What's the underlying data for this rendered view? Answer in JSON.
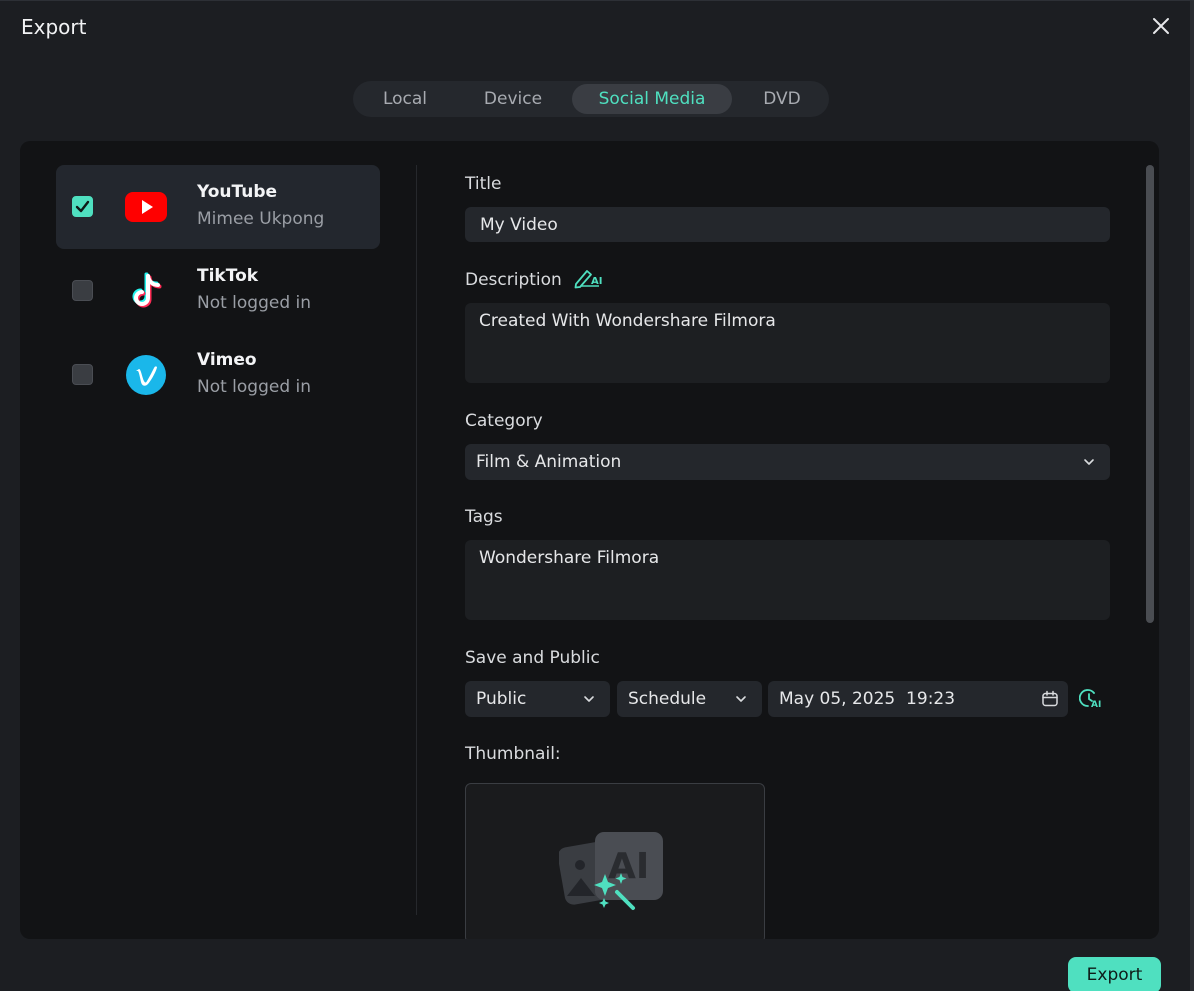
{
  "window": {
    "title": "Export"
  },
  "tabs": [
    {
      "label": "Local",
      "active": false
    },
    {
      "label": "Device",
      "active": false
    },
    {
      "label": "Social Media",
      "active": true
    },
    {
      "label": "DVD",
      "active": false
    }
  ],
  "platforms": [
    {
      "name": "YouTube",
      "status": "Mimee Ukpong",
      "checked": true,
      "icon": "youtube-icon"
    },
    {
      "name": "TikTok",
      "status": "Not logged in",
      "checked": false,
      "icon": "tiktok-icon"
    },
    {
      "name": "Vimeo",
      "status": "Not logged in",
      "checked": false,
      "icon": "vimeo-icon"
    }
  ],
  "form": {
    "title_label": "Title",
    "title_value": "My Video",
    "description_label": "Description",
    "description_value": "Created With Wondershare Filmora",
    "category_label": "Category",
    "category_value": "Film & Animation",
    "tags_label": "Tags",
    "tags_value": "Wondershare Filmora",
    "save_label": "Save and Public",
    "privacy_value": "Public",
    "publish_mode_value": "Schedule",
    "schedule_datetime": "May 05, 2025  19:23",
    "thumbnail_label": "Thumbnail:"
  },
  "footer": {
    "export_label": "Export"
  },
  "colors": {
    "accent": "#4fe0c0",
    "background": "#1c1e22",
    "panel": "#121315",
    "youtube_red": "#ff0000",
    "vimeo_blue": "#1ab7ea"
  }
}
